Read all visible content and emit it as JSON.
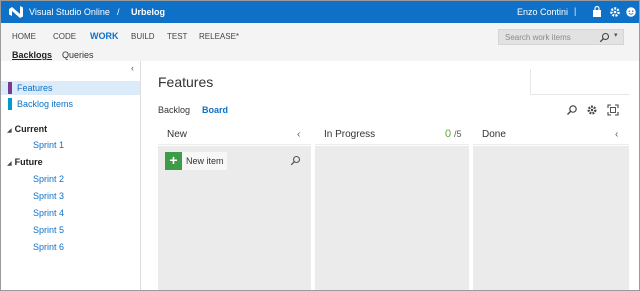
{
  "topbar": {
    "product": "Visual Studio Online",
    "separator": "/",
    "project": "Urbelog",
    "user": "Enzo Contini",
    "divider": "|",
    "brand_color": "#0e71c7",
    "icons": [
      "visual-studio-logo-icon",
      "shopping-bag-icon",
      "gear-icon",
      "smiley-icon",
      "help-icon"
    ]
  },
  "hubs": {
    "items": [
      "HOME",
      "CODE",
      "WORK",
      "BUILD",
      "TEST",
      "RELEASE*"
    ],
    "active": "WORK",
    "subtabs": [
      "Backlogs",
      "Queries"
    ],
    "active_subtab": "Backlogs"
  },
  "search": {
    "placeholder": "Search work items",
    "icon": "search-icon",
    "caret": "▾"
  },
  "left_panel": {
    "collapse": "‹",
    "backlogs": [
      {
        "label": "Features",
        "color": "#773b93"
      },
      {
        "label": "Backlog items",
        "color": "#009ccc"
      }
    ],
    "groups": [
      {
        "label": "Current",
        "sprints": [
          "Sprint 1"
        ]
      },
      {
        "label": "Future",
        "sprints": [
          "Sprint 2",
          "Sprint 3",
          "Sprint 4",
          "Sprint 5",
          "Sprint 6"
        ]
      }
    ],
    "tri": "◢"
  },
  "main": {
    "title": "Features",
    "tabs": [
      "Backlog",
      "Board"
    ],
    "active_tab": "Board",
    "toolbar_icons": [
      "search-icon",
      "gear-icon",
      "fullscreen-icon"
    ]
  },
  "board": {
    "columns": [
      {
        "name": "New",
        "arrow": "‹"
      },
      {
        "name": "In Progress",
        "count": "0",
        "limit": "/5"
      },
      {
        "name": "Done",
        "arrow": "‹"
      }
    ],
    "new_item_label": "New item",
    "plus": "+",
    "count_color": "#5aa832"
  }
}
